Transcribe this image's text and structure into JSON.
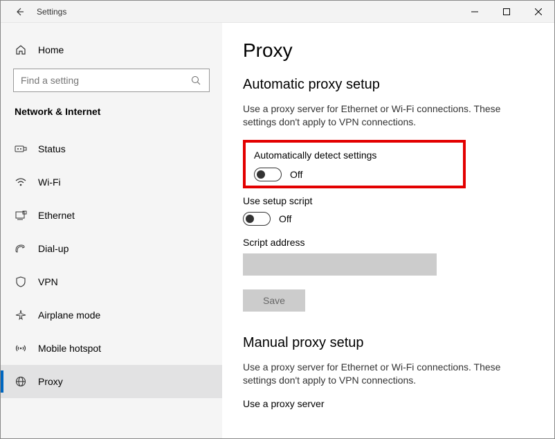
{
  "titlebar": {
    "title": "Settings"
  },
  "sidebar": {
    "home_label": "Home",
    "search_placeholder": "Find a setting",
    "section_header": "Network & Internet",
    "items": [
      {
        "label": "Status"
      },
      {
        "label": "Wi-Fi"
      },
      {
        "label": "Ethernet"
      },
      {
        "label": "Dial-up"
      },
      {
        "label": "VPN"
      },
      {
        "label": "Airplane mode"
      },
      {
        "label": "Mobile hotspot"
      },
      {
        "label": "Proxy"
      }
    ]
  },
  "main": {
    "page_title": "Proxy",
    "auto": {
      "heading": "Automatic proxy setup",
      "desc": "Use a proxy server for Ethernet or Wi-Fi connections. These settings don't apply to VPN connections.",
      "detect_label": "Automatically detect settings",
      "detect_state": "Off",
      "script_label": "Use setup script",
      "script_state": "Off",
      "script_addr_label": "Script address",
      "script_addr_value": "",
      "save_label": "Save"
    },
    "manual": {
      "heading": "Manual proxy setup",
      "desc": "Use a proxy server for Ethernet or Wi-Fi connections. These settings don't apply to VPN connections.",
      "use_proxy_label": "Use a proxy server"
    }
  }
}
